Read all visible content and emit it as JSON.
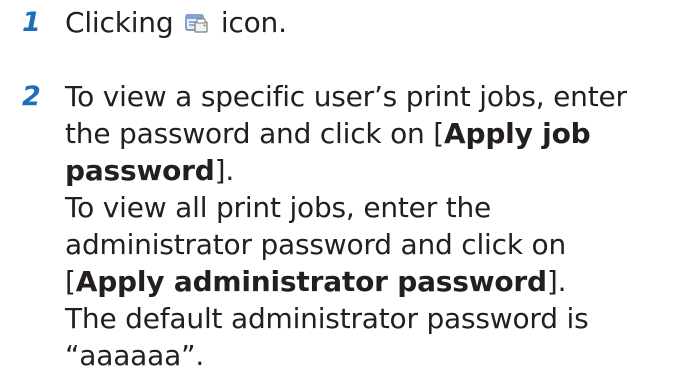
{
  "steps": [
    {
      "number": "1",
      "before_icon": "Clicking",
      "icon": "job-list-icon",
      "after_icon": "icon."
    },
    {
      "number": "2",
      "lines": {
        "l1": "To view a specific user’s print jobs, enter",
        "l2_pre": "the password and click on [",
        "l2_bold": "Apply job",
        "l3_bold": "password",
        "l3_post": "].",
        "l4": "To view all print jobs, enter the",
        "l5": "administrator password and click on",
        "l6_pre": "[",
        "l6_bold": "Apply administrator password",
        "l6_post": "].",
        "l7": "The default administrator password is",
        "l8": "“aaaaaa”."
      }
    }
  ]
}
